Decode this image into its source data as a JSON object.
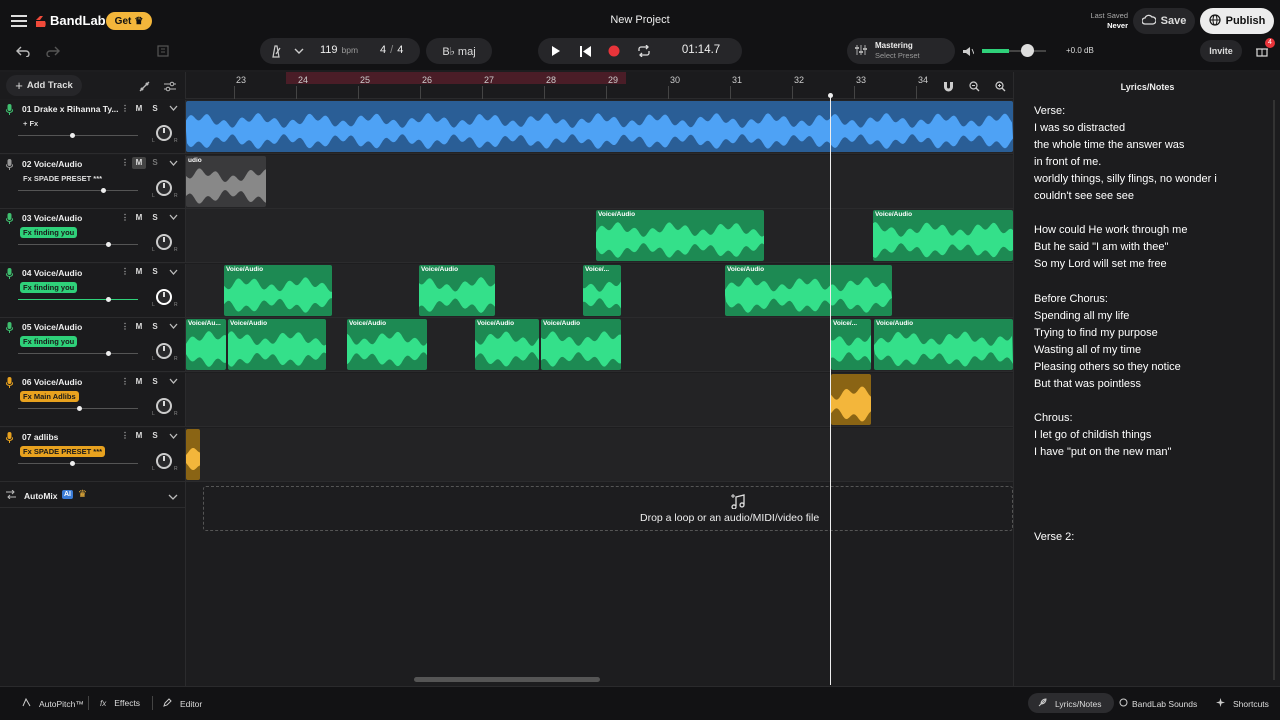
{
  "header": {
    "title": "New Project",
    "get_label": "Get",
    "last_saved_label": "Last Saved",
    "last_saved_value": "Never",
    "save_label": "Save",
    "publish_label": "Publish",
    "invite_label": "Invite",
    "gift_badge": "4"
  },
  "toolbar": {
    "bpm_value": "119",
    "bpm_unit": "bpm",
    "time_sig_num": "4",
    "time_sig_sep": "/",
    "time_sig_den": "4",
    "key": "B♭ maj",
    "time": "01:14.7",
    "mastering_label": "Mastering",
    "mastering_preset": "Select Preset",
    "volume_db": "+0.0 dB",
    "volume_level": 0.7
  },
  "tracks_panel": {
    "add_track_label": "Add Track"
  },
  "ruler": {
    "bars": [
      "23",
      "24",
      "25",
      "26",
      "27",
      "28",
      "29",
      "30",
      "31",
      "32",
      "33",
      "34"
    ]
  },
  "tracks": [
    {
      "name": "01  Drake x Rihanna Ty...",
      "fx": "+ Fx",
      "fx_style": "plain",
      "color": "#3a8ee6",
      "mic": "#3fbf6f"
    },
    {
      "name": "02  Voice/Audio",
      "fx": "Fx SPADE PRESET ***",
      "fx_style": "plain",
      "color": "#888",
      "mic": "#999"
    },
    {
      "name": "03  Voice/Audio",
      "fx": "Fx finding you",
      "fx_style": "green",
      "color": "#2fd17a",
      "mic": "#3fbf6f"
    },
    {
      "name": "04  Voice/Audio",
      "fx": "Fx finding you",
      "fx_style": "green",
      "color": "#2fd17a",
      "mic": "#3fbf6f"
    },
    {
      "name": "05  Voice/Audio",
      "fx": "Fx finding you",
      "fx_style": "green",
      "color": "#2fd17a",
      "mic": "#3fbf6f"
    },
    {
      "name": "06  Voice/Audio",
      "fx": "Fx Main Adlibs",
      "fx_style": "orange",
      "color": "#e8a21f",
      "mic": "#e8a21f"
    },
    {
      "name": "07  adlibs",
      "fx": "Fx SPADE PRESET ***",
      "fx_style": "orange",
      "color": "#e8a21f",
      "mic": "#e8a21f"
    }
  ],
  "track_buttons": {
    "mute": "M",
    "solo": "S"
  },
  "clip_labels": {
    "voice": "Voice/Audio",
    "voice_short": "Voice/...",
    "voice_short2": "Voice/Au...",
    "audio": "udio"
  },
  "automix": {
    "label": "AutoMix",
    "ai": "AI"
  },
  "drop_zone": {
    "text": "Drop a loop or an audio/MIDI/video file"
  },
  "lyrics": {
    "title": "Lyrics/Notes",
    "lines": [
      "Verse:",
      "I was so distracted",
      "the whole time the answer was",
      "in front of me.",
      "worldly things, silly flings, no wonder i",
      "couldn't see see see",
      "",
      "How could He work through me",
      "But he said \"I am with thee\"",
      "So my Lord will set me free",
      "",
      "Before Chorus:",
      "Spending all my life",
      "Trying to find my purpose",
      "Wasting all of my time",
      "Pleasing others so they notice",
      "But that was pointless",
      "",
      "Chrous:",
      "I let go of childish things",
      "I have \"put on the new man\"",
      "",
      "",
      "",
      "",
      "Verse 2:"
    ]
  },
  "bottom": {
    "autopitch": "AutoPitch™",
    "effects": "Effects",
    "editor": "Editor",
    "lyrics_notes": "Lyrics/Notes",
    "sounds": "BandLab Sounds",
    "shortcuts": "Shortcuts"
  }
}
